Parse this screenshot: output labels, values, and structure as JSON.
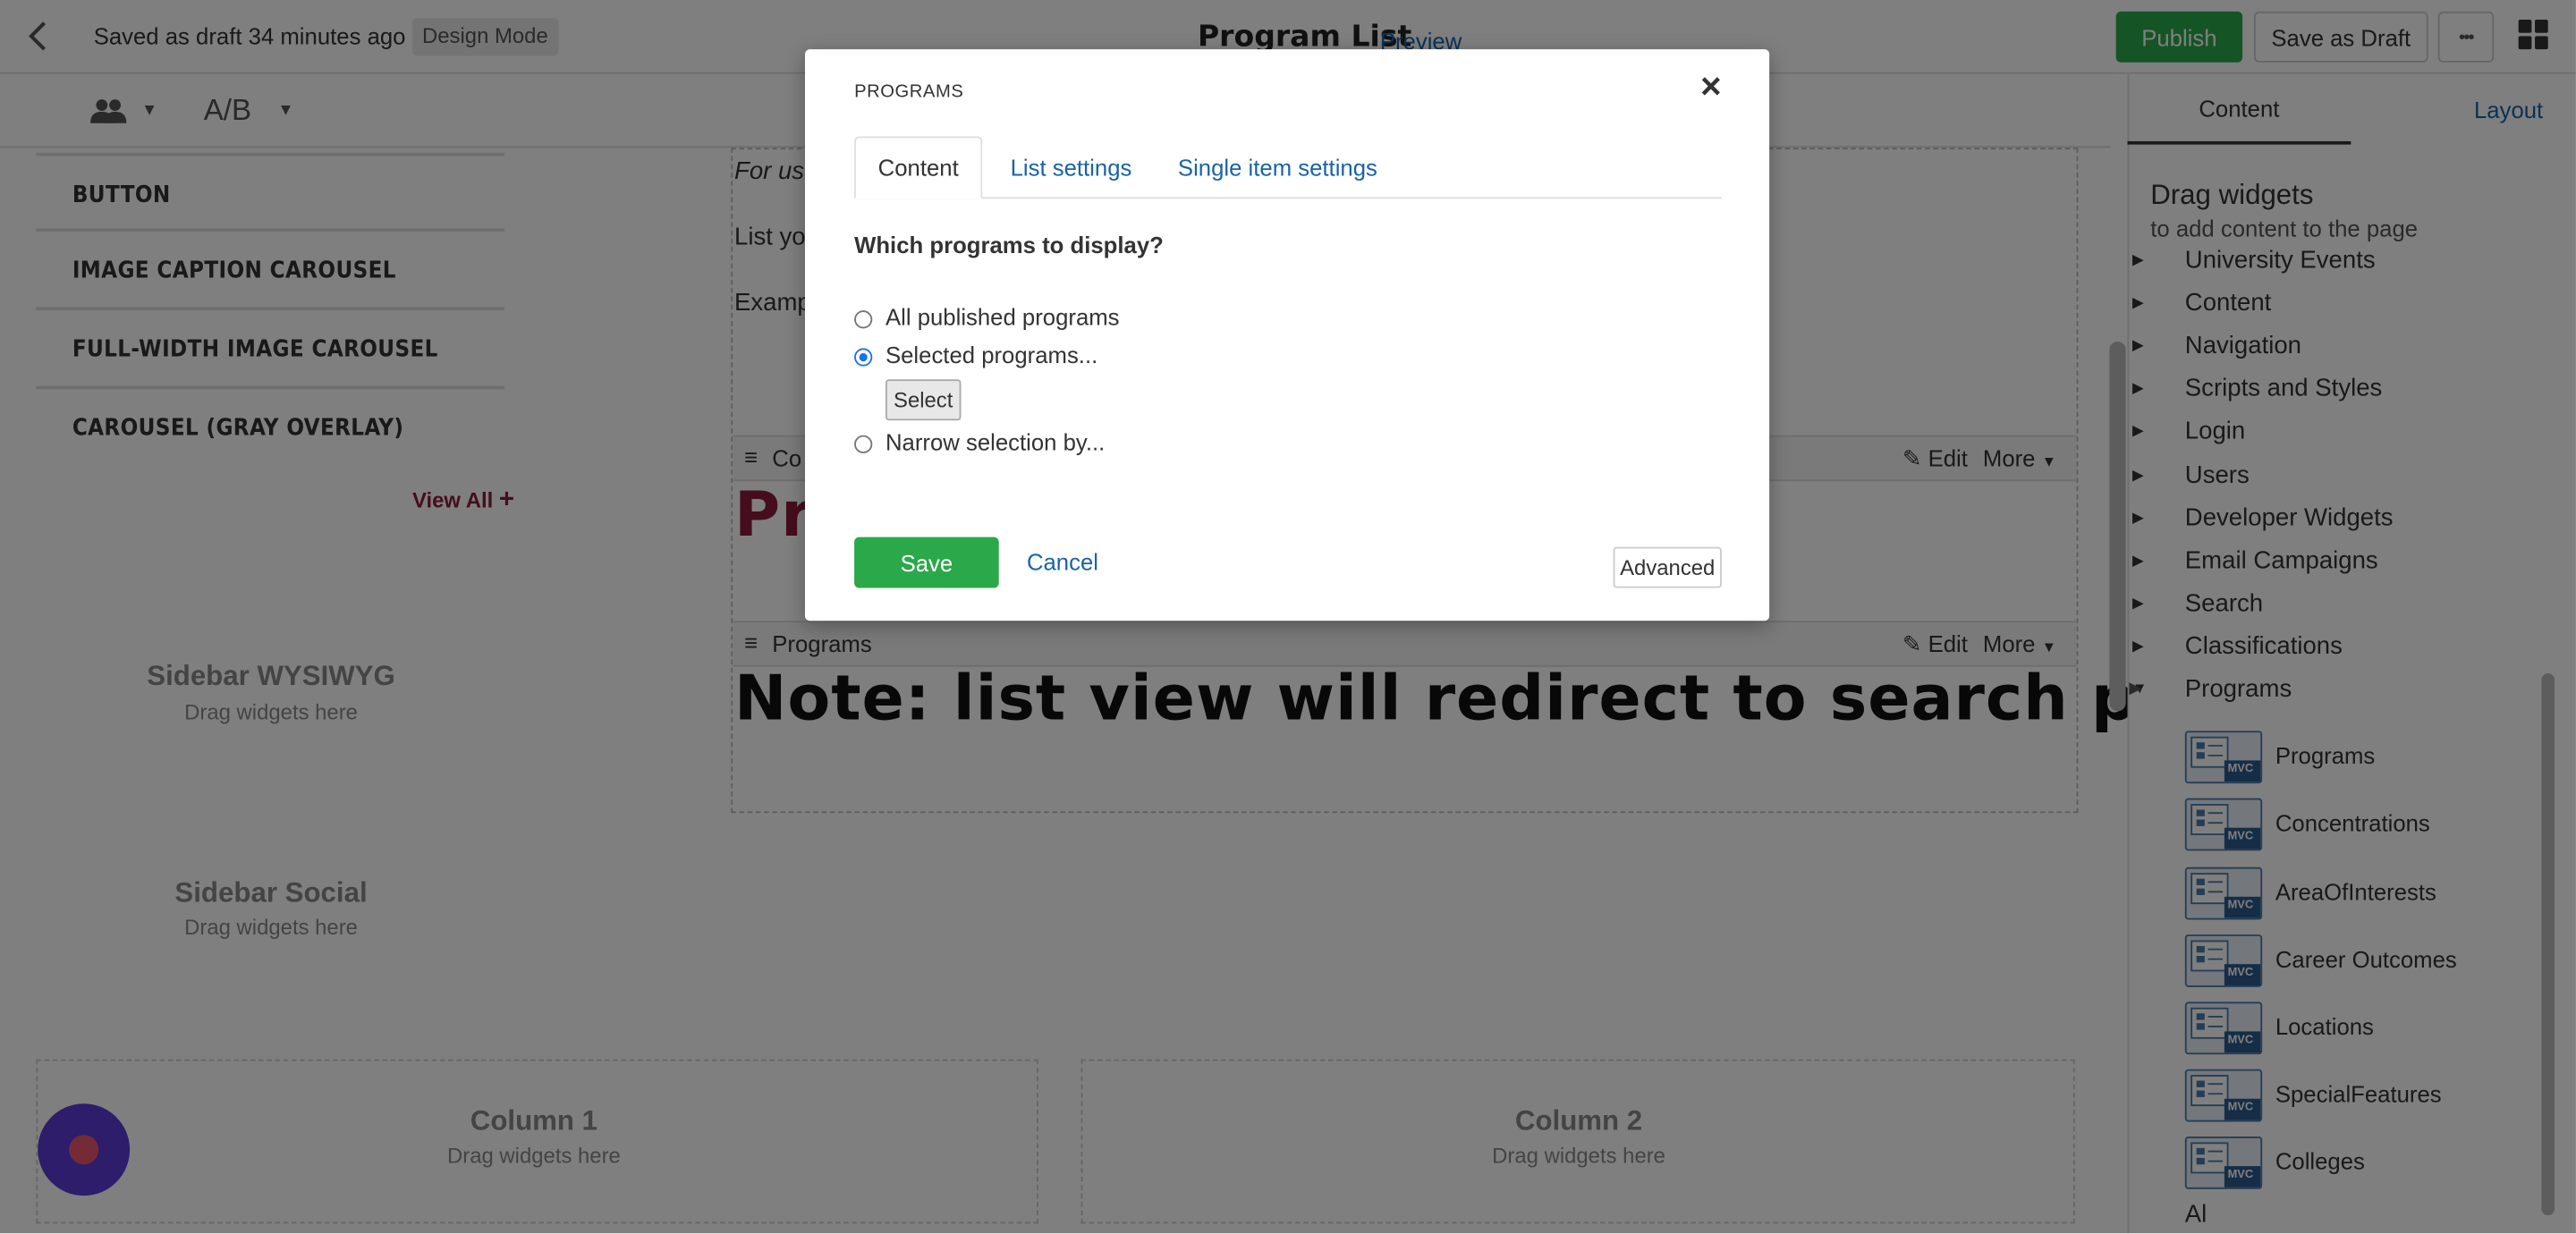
{
  "topbar": {
    "saved_text": "Saved as draft 34 minutes ago",
    "mode_badge": "Design Mode",
    "page_title": "Program List",
    "preview_label": "Preview",
    "publish_label": "Publish",
    "save_draft_label": "Save as Draft",
    "more_label": "•••"
  },
  "toolbar": {
    "ab_label": "A/B"
  },
  "left_widgets": [
    {
      "label": "BUTTON"
    },
    {
      "label": "IMAGE CAPTION CAROUSEL"
    },
    {
      "label": "FULL-WIDTH IMAGE CAROUSEL"
    },
    {
      "label": "CAROUSEL (GRAY OVERLAY)"
    }
  ],
  "view_all_label": "View All",
  "zones": {
    "sidebar_wysiwyg_title": "Sidebar WYSIWYG",
    "sidebar_social_title": "Sidebar Social",
    "column1_title": "Column 1",
    "column2_title": "Column 2",
    "drag_hint": "Drag widgets here"
  },
  "content": {
    "line1": "For use",
    "line2": "List you",
    "line3": "Examp",
    "widget1_name": "Co",
    "widget1_heading": "Pr",
    "widget2_name": "Programs",
    "widget2_heading": "Note: list view will redirect to search page.",
    "edit_label": "Edit",
    "more_label": "More"
  },
  "right_panel": {
    "tab_content": "Content",
    "tab_layout": "Layout",
    "drag_title": "Drag widgets",
    "drag_sub": "to add content to the page",
    "categories": [
      "University Events",
      "Content",
      "Navigation",
      "Scripts and Styles",
      "Login",
      "Users",
      "Developer Widgets",
      "Email Campaigns",
      "Search",
      "Classifications",
      "Programs"
    ],
    "program_widgets": [
      "Programs",
      "Concentrations",
      "AreaOfInterests",
      "Career Outcomes",
      "Locations",
      "SpecialFeatures",
      "Colleges"
    ],
    "mvc_label": "MVC",
    "bottom_partial": "Al"
  },
  "modal": {
    "heading": "PROGRAMS",
    "close_glyph": "×",
    "tabs": [
      "Content",
      "List settings",
      "Single item settings"
    ],
    "question": "Which programs to display?",
    "options": [
      "All published programs",
      "Selected programs...",
      "Narrow selection by..."
    ],
    "select_label": "Select",
    "save_label": "Save",
    "cancel_label": "Cancel",
    "advanced_label": "Advanced"
  },
  "colors": {
    "publish_green": "#2ba84a",
    "link_blue": "#1a63a6",
    "maroon": "#8b1a3a",
    "fab_purple": "#5b3bd6"
  }
}
